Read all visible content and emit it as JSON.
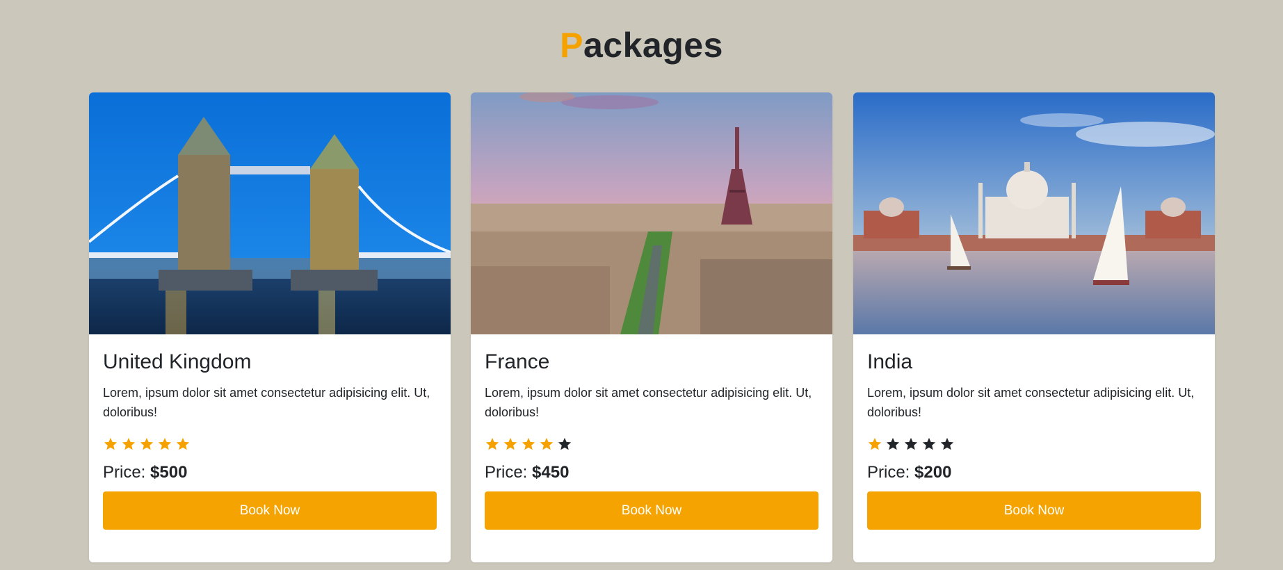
{
  "section": {
    "title_first_letter": "P",
    "title_rest": "ackages",
    "accent_color": "#f5a200"
  },
  "packages": [
    {
      "name": "United Kingdom",
      "description": "Lorem, ipsum dolor sit amet consectetur adipisicing elit. Ut, doloribus!",
      "rating": 5,
      "price_label": "Price:",
      "price_value": "$500",
      "button_label": "Book Now",
      "image": "tower-bridge-night-photo"
    },
    {
      "name": "France",
      "description": "Lorem, ipsum dolor sit amet consectetur adipisicing elit. Ut, doloribus!",
      "rating": 4,
      "price_label": "Price:",
      "price_value": "$450",
      "button_label": "Book Now",
      "image": "paris-eiffel-tower-photo"
    },
    {
      "name": "India",
      "description": "Lorem, ipsum dolor sit amet consectetur adipisicing elit. Ut, doloribus!",
      "rating": 1,
      "price_label": "Price:",
      "price_value": "$200",
      "button_label": "Book Now",
      "image": "taj-mahal-photo"
    }
  ],
  "colors": {
    "star_filled": "#f5a200",
    "star_empty": "#212529",
    "button": "#f5a300"
  },
  "icons": {
    "rating": "star-icon"
  }
}
